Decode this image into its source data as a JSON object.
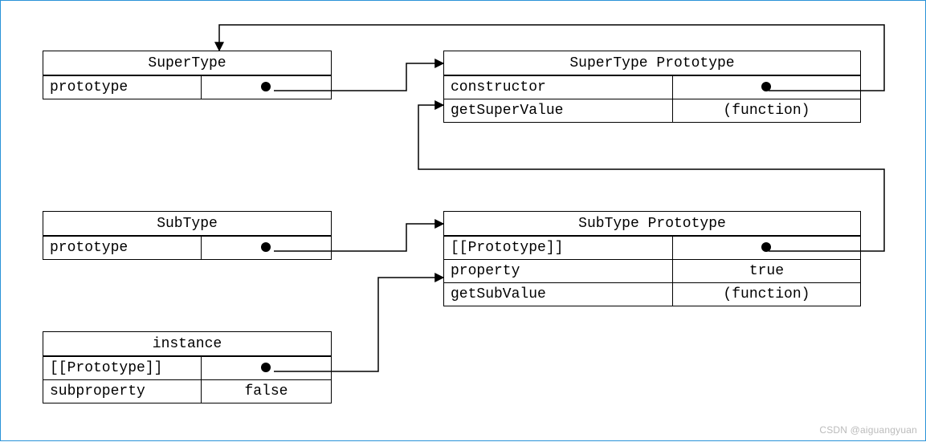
{
  "diagram": {
    "supertype": {
      "title": "SuperType",
      "rows": [
        {
          "label": "prototype",
          "value": "•"
        }
      ]
    },
    "supertype_prototype": {
      "title": "SuperType Prototype",
      "rows": [
        {
          "label": "constructor",
          "value": "•"
        },
        {
          "label": "getSuperValue",
          "value": "(function)"
        }
      ]
    },
    "subtype": {
      "title": "SubType",
      "rows": [
        {
          "label": "prototype",
          "value": "•"
        }
      ]
    },
    "subtype_prototype": {
      "title": "SubType Prototype",
      "rows": [
        {
          "label": "[[Prototype]]",
          "value": "•"
        },
        {
          "label": "property",
          "value": "true"
        },
        {
          "label": "getSubValue",
          "value": "(function)"
        }
      ]
    },
    "instance": {
      "title": "instance",
      "rows": [
        {
          "label": "[[Prototype]]",
          "value": "•"
        },
        {
          "label": "subproperty",
          "value": "false"
        }
      ]
    }
  },
  "watermark": "CSDN @aiguangyuan"
}
